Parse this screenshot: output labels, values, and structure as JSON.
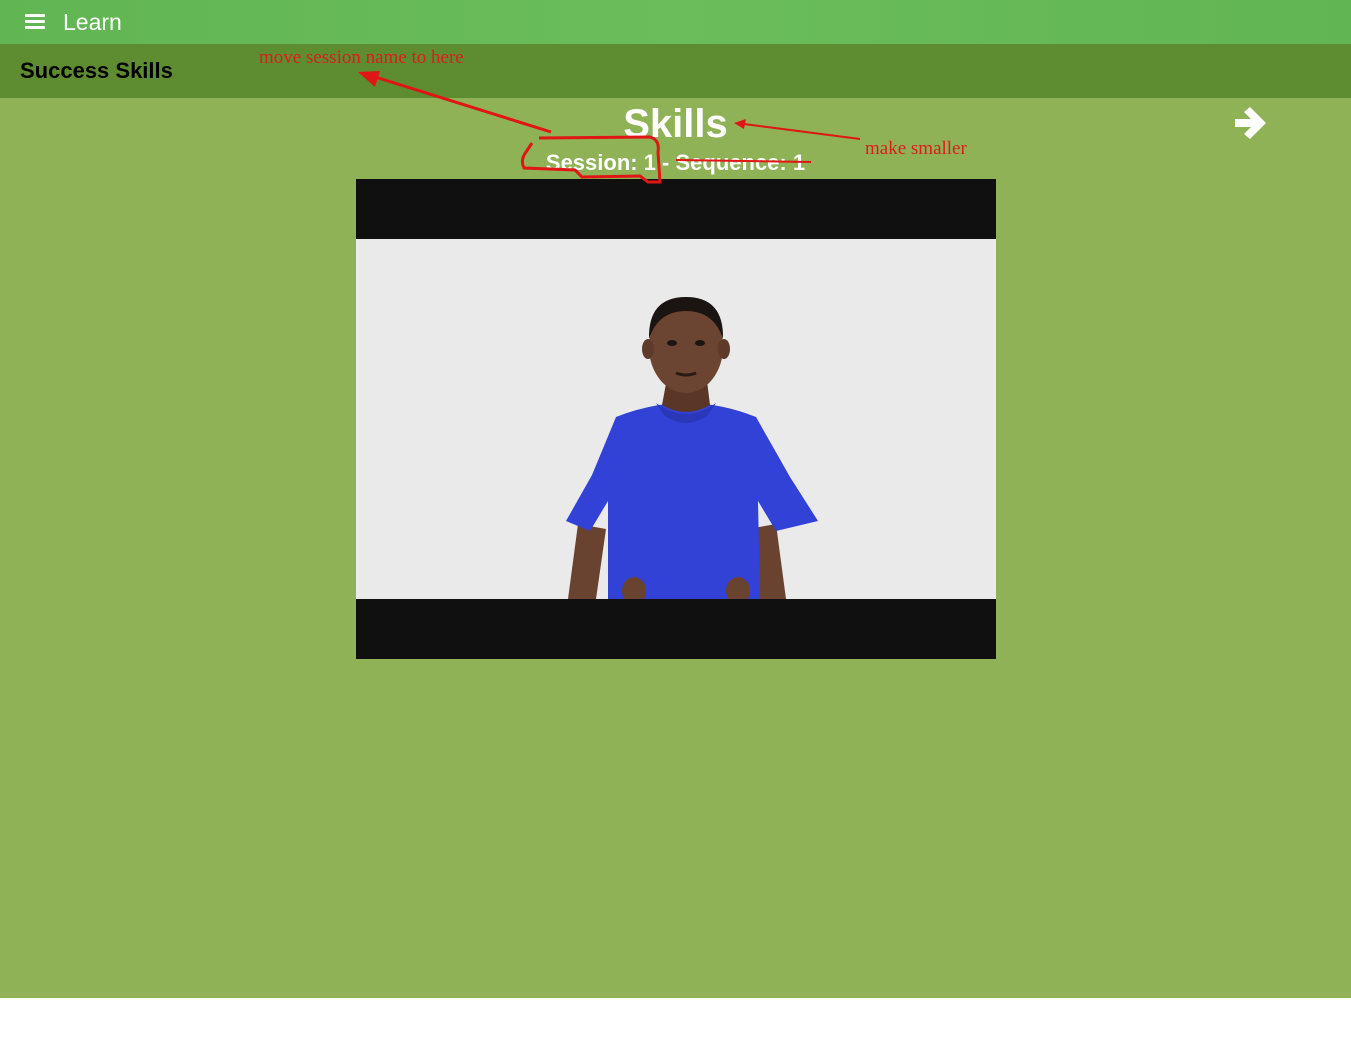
{
  "header": {
    "menu_icon": "hamburger-menu-icon",
    "title": "Learn"
  },
  "subheader": {
    "title": "Success Skills"
  },
  "lesson": {
    "title": "Skills",
    "session_line": "Session: 1 - Sequence: 1",
    "next_icon": "arrow-right-icon"
  },
  "annotations": {
    "move_note": "move session name to here",
    "size_note": "make smaller",
    "color": "#dd1c1c"
  },
  "colors": {
    "header_green": "#62b553",
    "subheader_green": "#5e8c31",
    "content_green": "#8eb255",
    "video_bar": "#101010",
    "shirt_blue": "#3242d6"
  }
}
